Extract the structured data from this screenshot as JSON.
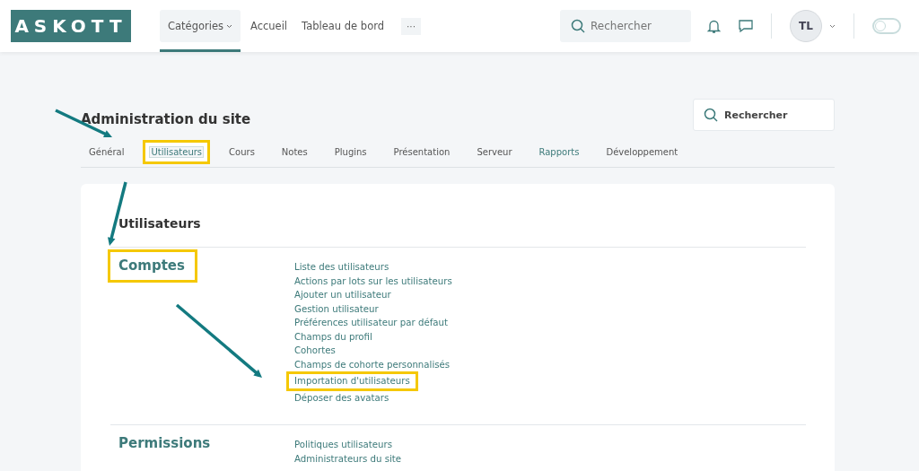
{
  "header": {
    "logo": "ASKOTT",
    "nav": [
      {
        "label": "Catégories",
        "selected": true
      },
      {
        "label": "Accueil",
        "selected": false
      },
      {
        "label": "Tableau de bord",
        "selected": false
      }
    ],
    "more": "···",
    "search": {
      "placeholder": "Rechercher"
    },
    "avatar": "TL",
    "dark_mode": {
      "on": false
    }
  },
  "page": {
    "title": "Administration du site",
    "search": {
      "placeholder": "Rechercher"
    },
    "tabs": [
      {
        "label": "Général",
        "selected": false,
        "highlighted": false
      },
      {
        "label": "Utilisateurs",
        "selected": true,
        "highlighted": true
      },
      {
        "label": "Cours",
        "selected": false,
        "highlighted": false
      },
      {
        "label": "Notes",
        "selected": false,
        "highlighted": false
      },
      {
        "label": "Plugins",
        "selected": false,
        "highlighted": false
      },
      {
        "label": "Présentation",
        "selected": false,
        "highlighted": false
      },
      {
        "label": "Serveur",
        "selected": false,
        "highlighted": false
      },
      {
        "label": "Rapports",
        "selected": false,
        "highlighted": false
      },
      {
        "label": "Développement",
        "selected": false,
        "highlighted": false
      }
    ],
    "heading": "Utilisateurs",
    "sections": [
      {
        "title": "Comptes",
        "highlighted": true,
        "links": [
          {
            "label": "Liste des utilisateurs",
            "highlighted": false
          },
          {
            "label": "Actions par lots sur les utilisateurs",
            "highlighted": false
          },
          {
            "label": "Ajouter un utilisateur",
            "highlighted": false
          },
          {
            "label": "Gestion utilisateur",
            "highlighted": false
          },
          {
            "label": "Préférences utilisateur par défaut",
            "highlighted": false
          },
          {
            "label": "Champs du profil",
            "highlighted": false
          },
          {
            "label": "Cohortes",
            "highlighted": false
          },
          {
            "label": "Champs de cohorte personnalisés",
            "highlighted": false
          },
          {
            "label": "Importation d'utilisateurs",
            "highlighted": true
          },
          {
            "label": "Déposer des avatars",
            "highlighted": false
          }
        ]
      },
      {
        "title": "Permissions",
        "highlighted": false,
        "links": [
          {
            "label": "Politiques utilisateurs",
            "highlighted": false
          },
          {
            "label": "Administrateurs du site",
            "highlighted": false
          }
        ]
      }
    ]
  }
}
